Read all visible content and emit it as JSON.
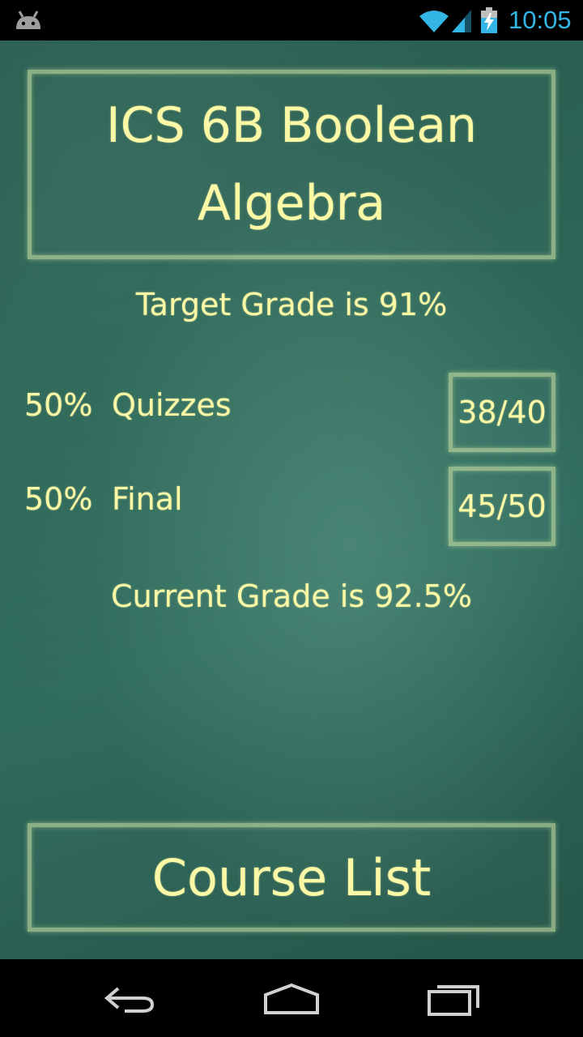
{
  "status_bar": {
    "time": "10:05",
    "icons": [
      "android-icon",
      "wifi-icon",
      "signal-icon",
      "battery-charging-icon"
    ],
    "icon_color": "#33b5e5"
  },
  "course": {
    "title": "ICS 6B Boolean Algebra",
    "target_grade_text": "Target Grade is 91%",
    "current_grade_text": "Current Grade is 92.5%"
  },
  "components": [
    {
      "weight": "50%",
      "label": "Quizzes",
      "score": "38/40"
    },
    {
      "weight": "50%",
      "label": "Final",
      "score": "45/50"
    }
  ],
  "course_list_button": {
    "label": "Course List"
  },
  "nav_bar": {
    "buttons": [
      "back-icon",
      "home-icon",
      "recent-apps-icon"
    ]
  },
  "colors": {
    "chalk_text": "#fbf8a6",
    "board": "#2c6657"
  }
}
